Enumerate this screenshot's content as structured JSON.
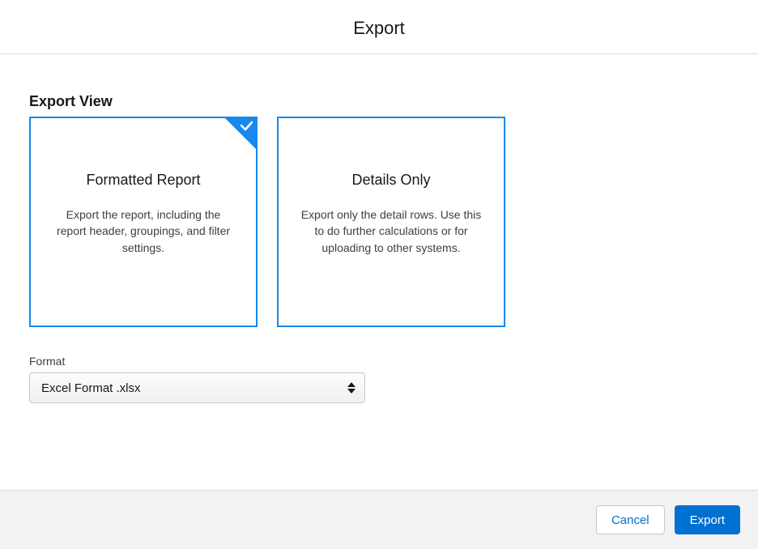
{
  "header": {
    "title": "Export"
  },
  "sections": {
    "export_view": {
      "title": "Export View",
      "cards": [
        {
          "title": "Formatted Report",
          "desc": "Export the report, including the report header, groupings, and filter settings.",
          "selected": true
        },
        {
          "title": "Details Only",
          "desc": "Export only the detail rows. Use this to do further calculations or for uploading to other systems.",
          "selected": false
        }
      ]
    },
    "format": {
      "label": "Format",
      "value": "Excel Format .xlsx"
    }
  },
  "footer": {
    "cancel_label": "Cancel",
    "export_label": "Export"
  },
  "colors": {
    "brand": "#0070d2",
    "card_border": "#1589ee"
  }
}
